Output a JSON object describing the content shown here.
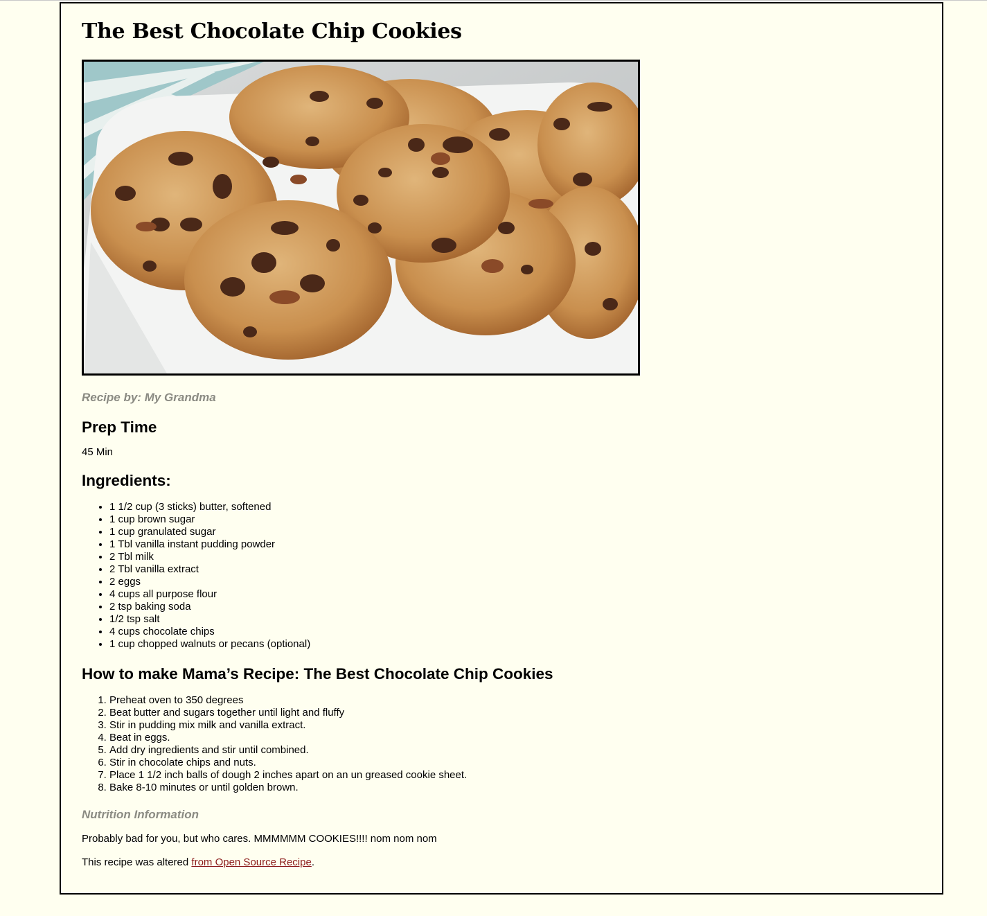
{
  "recipe": {
    "title": "The Best Chocolate Chip Cookies",
    "byline": "Recipe by: My Grandma",
    "prep_heading": "Prep Time",
    "prep_value": "45 Min",
    "ingredients_heading": "Ingredients:",
    "ingredients": [
      "1 1/2 cup (3 sticks) butter, softened",
      "1 cup brown sugar",
      "1 cup granulated sugar",
      "1 Tbl vanilla instant pudding powder",
      "2 Tbl milk",
      "2 Tbl vanilla extract",
      "2 eggs",
      "4 cups all purpose flour",
      "2 tsp baking soda",
      "1/2 tsp salt",
      "4 cups chocolate chips",
      "1 cup chopped walnuts or pecans (optional)"
    ],
    "steps_heading": "How to make Mama’s Recipe: The Best Chocolate Chip Cookies",
    "steps": [
      "Preheat oven to 350 degrees",
      "Beat butter and sugars together until light and fluffy",
      "Stir in pudding mix milk and vanilla extract.",
      "Beat in eggs.",
      "Add dry ingredients and stir until combined.",
      "Stir in chocolate chips and nuts.",
      "Place 1 1/2 inch balls of dough 2 inches apart on an un greased cookie sheet.",
      "Bake 8-10 minutes or until golden brown."
    ],
    "nutrition_heading": "Nutrition Information",
    "nutrition_text": "Probably bad for you, but who cares. MMMMMM COOKIES!!!! nom nom nom",
    "credit_prefix": "This recipe was altered ",
    "credit_link": "from Open Source Recipe",
    "credit_suffix": "."
  },
  "colors": {
    "page_background": "#fffff0",
    "muted_heading": "#8b8b83",
    "link": "#8b1a1a",
    "border": "#000000"
  },
  "image": {
    "subject": "cookies-photo"
  }
}
